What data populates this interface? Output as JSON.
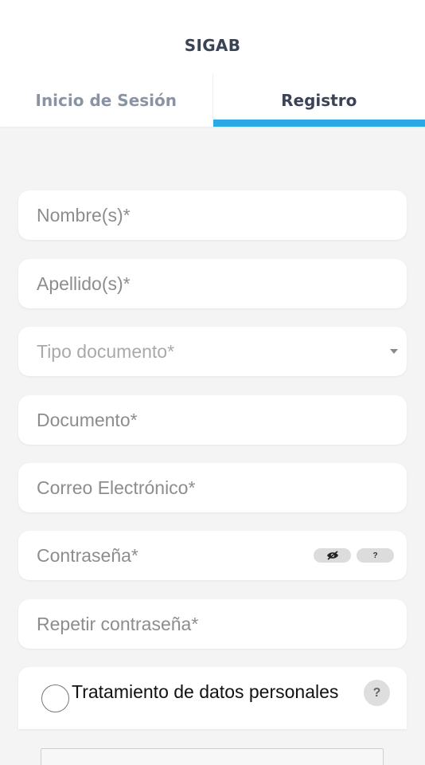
{
  "app": {
    "title": "SIGAB"
  },
  "tabs": [
    {
      "label": "Inicio de Sesión",
      "active": false
    },
    {
      "label": "Registro",
      "active": true
    }
  ],
  "form": {
    "fields": {
      "nombres": "Nombre(s)*",
      "apellidos": "Apellido(s)*",
      "tipo_documento": "Tipo documento*",
      "documento": "Documento*",
      "correo": "Correo Electrónico*",
      "contrasena": "Contraseña*",
      "repetir_contrasena": "Repetir contraseña*"
    },
    "password_help_glyph": "?",
    "consent": {
      "label": "Tratamiento de datos personales",
      "help_glyph": "?",
      "checked": false
    }
  },
  "colors": {
    "accent": "#2aa9e4",
    "title": "#3a4456",
    "inactive_tab": "#8a93a3",
    "background": "#f4f4f4"
  },
  "icons": [
    "eye-off-icon",
    "help-icon",
    "chevron-down-icon",
    "radio-icon"
  ]
}
